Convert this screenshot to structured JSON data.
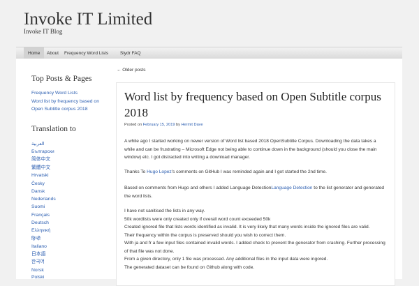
{
  "site": {
    "title": "Invoke IT Limited",
    "description": "Invoke IT Blog"
  },
  "nav": {
    "items": [
      {
        "label": "Home",
        "active": true
      },
      {
        "label": "About"
      },
      {
        "label": "Frequency Word Lists"
      },
      {
        "label": "Slydr FAQ"
      }
    ]
  },
  "sidebar": {
    "top_posts": {
      "heading": "Top Posts & Pages",
      "items": [
        "Frequency Word Lists",
        "Word list by frequency based on",
        "Open Subtitle corpus 2018"
      ]
    },
    "translation": {
      "heading": "Translation to",
      "languages": [
        "العربية",
        "Български",
        "简体中文",
        "繁體中文",
        "Hrvatski",
        "Česky",
        "Dansk",
        "Nederlands",
        "Suomi",
        "Français",
        "Deutsch",
        "Ελληνική",
        "हिन्दी",
        "Italiano",
        "日本語",
        "한국어",
        "Norsk",
        "Polski"
      ]
    }
  },
  "main": {
    "older_posts": "← Older posts",
    "post": {
      "title": "Word list by frequency based on Open Subtitle corpus 2018",
      "meta": {
        "posted_on": "Posted on ",
        "date": "February 15, 2019",
        "by": " by ",
        "author": "Hermit Dave"
      },
      "p1": "A while ago I started working on newer version of Word list based 2018 OpenSubtitle Corpus. Downloading the data takes a while and can be frustrating – Microsoft Edge not being able to continue down in the background (should you close the main window) etc. I got distracted into writing a download manager.",
      "p2": {
        "before": "Thanks To ",
        "link": "Hugo Lopez",
        "after": "'s comments on GitHub I was reminded again and I got started the 2nd time."
      },
      "p3": {
        "before": "Based on comments from Hugo and others I added Language Detection",
        "link": "Language Detection",
        "after": " to the list generator and generated the word lists."
      },
      "lines": [
        "I have not sanitised the lists in any way.",
        "50k wordlists were only created only if overall word count exceeded 50k",
        "Created ignored file that lists words identified as invalid. It is very likely that many words inside the ignored files are valid.",
        "Their frequency within the corpus is preserved should you wish to correct them.",
        "With ja and fr a few input files contained invalid words. I added check to prevent the generator from crashing. Further processing of that file was not done.",
        "From a given directory, only 1 file was processed. Any additional files in the input data were ingored.",
        "The generated dataset can be found on Github along with code."
      ]
    }
  }
}
